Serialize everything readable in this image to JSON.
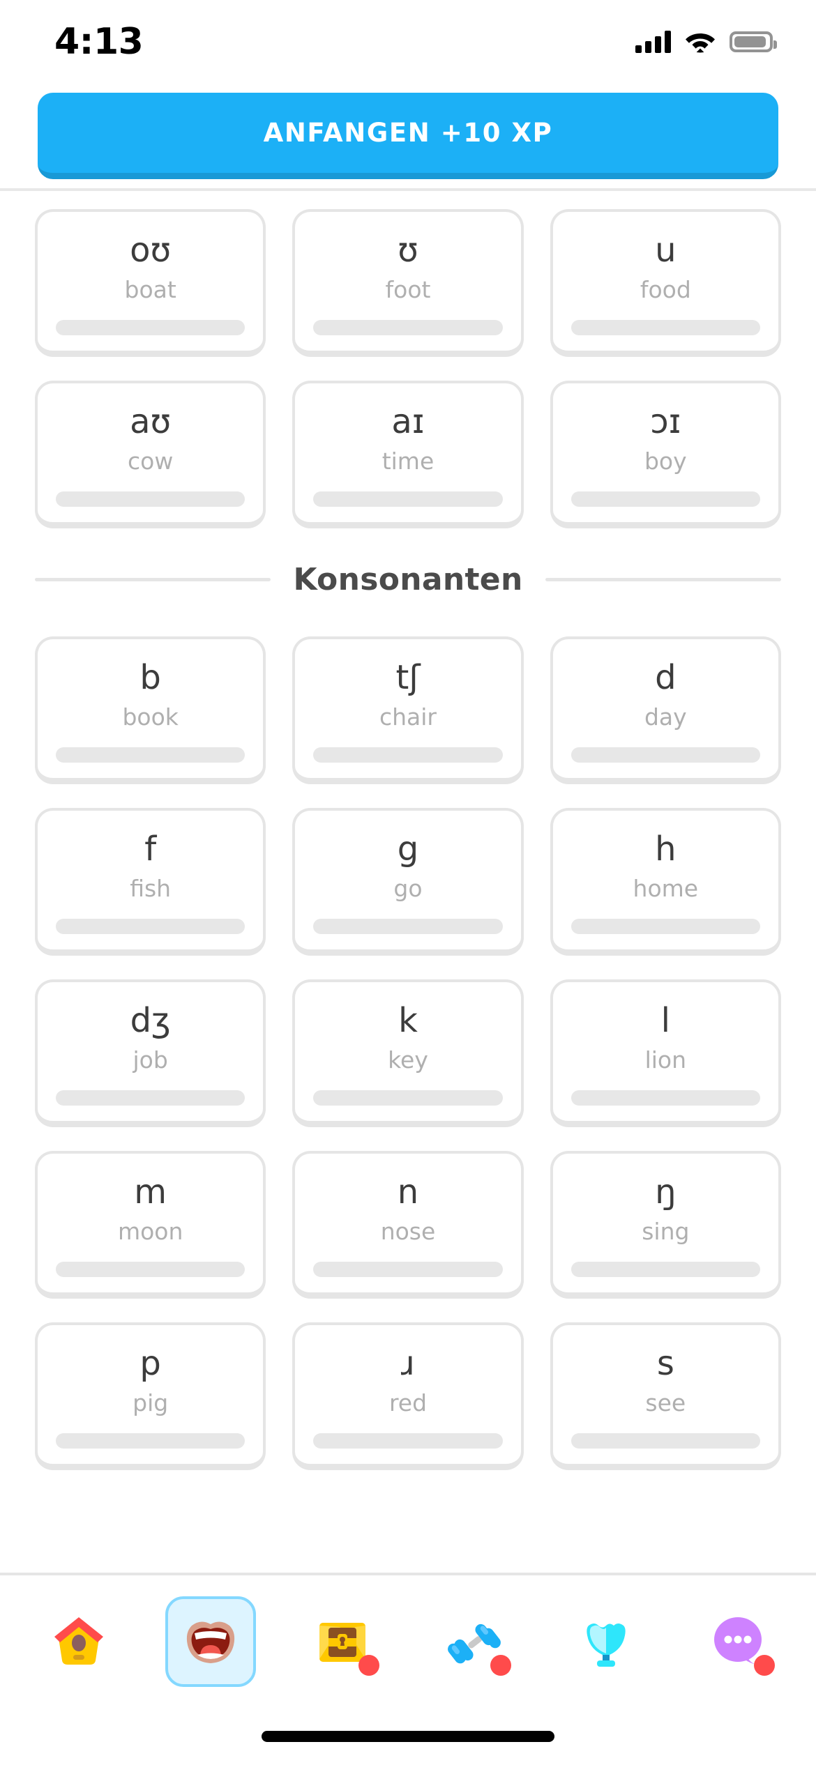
{
  "status_bar": {
    "time": "4:13",
    "signal_icon": "cellular-signal-icon",
    "wifi_icon": "wifi-icon",
    "battery_icon": "battery-icon"
  },
  "cta": {
    "label": "ANFANGEN +10 XP",
    "color": "#1cb0f6",
    "shadow_color": "#1899d6"
  },
  "colors": {
    "accent_blue": "#1cb0f6",
    "card_border": "#e5e5e5",
    "symbol_text": "#3c3c3c",
    "word_text": "#afafaf",
    "section_title": "#4b4b4b",
    "badge_red": "#ff4b4b",
    "active_tab_bg": "#ddf4ff",
    "active_tab_border": "#84d8ff"
  },
  "vowels": {
    "cards": [
      {
        "symbol": "oʊ",
        "word": "boat",
        "progress": 0
      },
      {
        "symbol": "ʊ",
        "word": "foot",
        "progress": 0
      },
      {
        "symbol": "u",
        "word": "food",
        "progress": 0
      },
      {
        "symbol": "aʊ",
        "word": "cow",
        "progress": 0
      },
      {
        "symbol": "aɪ",
        "word": "time",
        "progress": 0
      },
      {
        "symbol": "ɔɪ",
        "word": "boy",
        "progress": 0
      }
    ]
  },
  "consonants_section": {
    "title": "Konsonanten",
    "cards": [
      {
        "symbol": "b",
        "word": "book",
        "progress": 0
      },
      {
        "symbol": "tʃ",
        "word": "chair",
        "progress": 0
      },
      {
        "symbol": "d",
        "word": "day",
        "progress": 0
      },
      {
        "symbol": "f",
        "word": "fish",
        "progress": 0
      },
      {
        "symbol": "g",
        "word": "go",
        "progress": 0
      },
      {
        "symbol": "h",
        "word": "home",
        "progress": 0
      },
      {
        "symbol": "dʒ",
        "word": "job",
        "progress": 0
      },
      {
        "symbol": "k",
        "word": "key",
        "progress": 0
      },
      {
        "symbol": "l",
        "word": "lion",
        "progress": 0
      },
      {
        "symbol": "m",
        "word": "moon",
        "progress": 0
      },
      {
        "symbol": "n",
        "word": "nose",
        "progress": 0
      },
      {
        "symbol": "ŋ",
        "word": "sing",
        "progress": 0
      },
      {
        "symbol": "p",
        "word": "pig",
        "progress": 0
      },
      {
        "symbol": "ɹ",
        "word": "red",
        "progress": 0
      },
      {
        "symbol": "s",
        "word": "see",
        "progress": 0
      }
    ]
  },
  "tabbar": {
    "items": [
      {
        "icon": "home-birdhouse-icon",
        "active": false,
        "badge": false
      },
      {
        "icon": "mouth-icon",
        "active": true,
        "badge": false
      },
      {
        "icon": "treasure-chest-icon",
        "active": false,
        "badge": true
      },
      {
        "icon": "dumbbell-icon",
        "active": false,
        "badge": true
      },
      {
        "icon": "trophy-icon",
        "active": false,
        "badge": false
      },
      {
        "icon": "more-ellipsis-icon",
        "active": false,
        "badge": true
      }
    ]
  }
}
